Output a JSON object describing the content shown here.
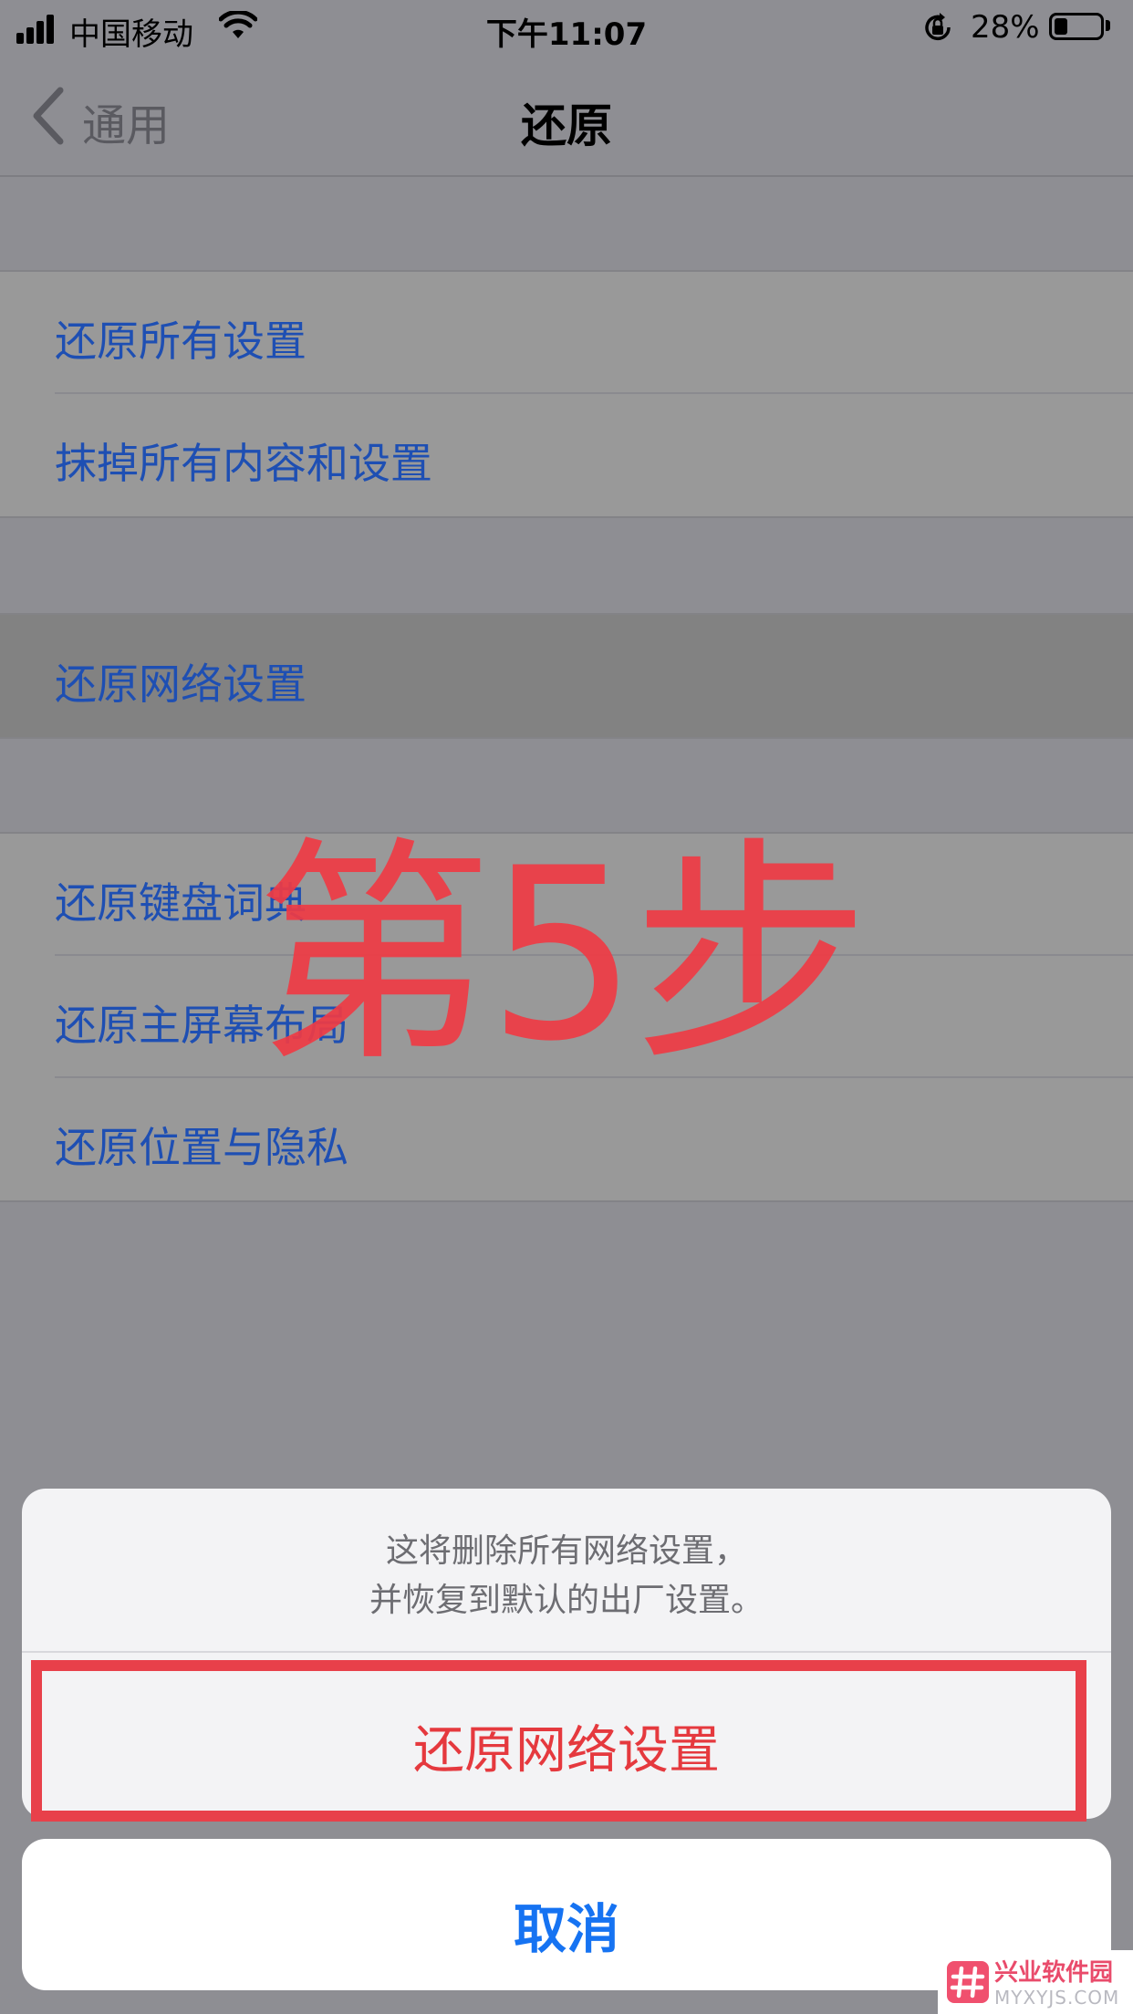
{
  "status_bar": {
    "carrier": "中国移动",
    "time": "下午11:07",
    "battery_percent": "28%",
    "battery_level": 0.28,
    "icons": [
      "signal-icon",
      "wifi-icon",
      "orientation-lock-icon",
      "battery-icon"
    ]
  },
  "nav": {
    "back_label": "通用",
    "title": "还原"
  },
  "groups": [
    {
      "items": [
        {
          "label": "还原所有设置"
        },
        {
          "label": "抹掉所有内容和设置"
        }
      ]
    },
    {
      "items": [
        {
          "label": "还原网络设置",
          "highlighted": true
        }
      ]
    },
    {
      "items": [
        {
          "label": "还原键盘词典"
        },
        {
          "label": "还原主屏幕布局"
        },
        {
          "label": "还原位置与隐私"
        }
      ]
    }
  ],
  "overlay": {
    "step_text": "第5步",
    "color": "#ef3b45"
  },
  "action_sheet": {
    "message_line1": "这将删除所有网络设置，",
    "message_line2": "并恢复到默认的出厂设置。",
    "destructive_label": "还原网络设置",
    "cancel_label": "取消"
  },
  "watermark": {
    "name": "兴业软件园",
    "url": "MYXYJS.COM"
  },
  "colors": {
    "link_blue": "#1e4fb3",
    "destructive_red": "#e5393e",
    "cancel_blue": "#1673f2",
    "annotation_red": "#e8404a"
  }
}
